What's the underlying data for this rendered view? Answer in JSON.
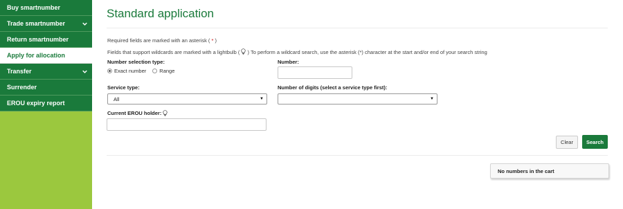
{
  "sidebar": {
    "items": [
      {
        "label": "Buy smartnumber",
        "icon": "",
        "active": false
      },
      {
        "label": "Trade smartnumber",
        "icon": "chevron-down-icon",
        "active": false
      },
      {
        "label": "Return smartnumber",
        "icon": "",
        "active": false
      },
      {
        "label": "Apply for allocation",
        "icon": "",
        "active": true
      },
      {
        "label": "Transfer",
        "icon": "chevron-down-icon",
        "active": false
      },
      {
        "label": "Surrender",
        "icon": "",
        "active": false
      },
      {
        "label": "EROU expiry report",
        "icon": "",
        "active": false
      }
    ]
  },
  "page": {
    "title": "Standard application",
    "note_required_before": "Required fields are marked with an asterisk ( ",
    "note_required_asterisk": "*",
    "note_required_after": " )",
    "note_wildcard_before": "Fields that support wildcards are marked with a lightbulb ( ",
    "note_wildcard_after": " ) To perform a wildcard search, use the asterisk (*) character at the start and/or end of your search string"
  },
  "form": {
    "selection_type_label": "Number selection type:",
    "radio_exact": "Exact number",
    "radio_range": "Range",
    "selected": "Exact number",
    "number_label": "Number:",
    "number_value": "",
    "service_type_label": "Service type:",
    "service_type_value": "All",
    "digits_label": "Number of digits (select a service type first):",
    "digits_value": "",
    "holder_label": "Current EROU holder:",
    "holder_value": ""
  },
  "buttons": {
    "clear": "Clear",
    "search": "Search"
  },
  "cart": {
    "status": "No numbers in the cart"
  },
  "colors": {
    "brand_green": "#1a7a3b",
    "sidebar_lime": "#9bc83e",
    "required_red": "#cc0000"
  }
}
